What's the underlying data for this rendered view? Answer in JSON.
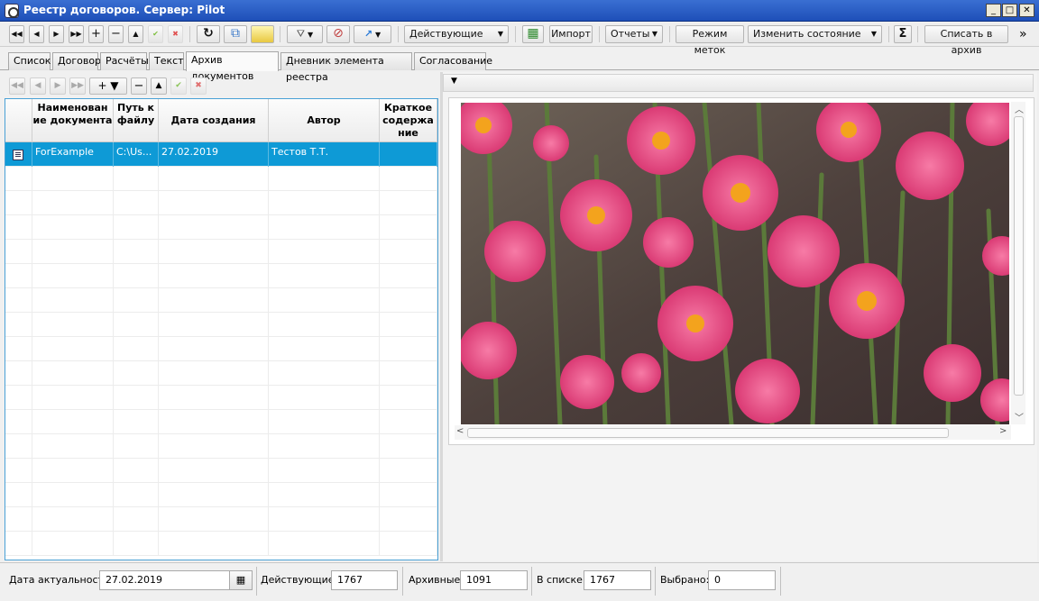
{
  "window": {
    "title": "Реестр договоров. Сервер: Pilot",
    "minimize": "_",
    "maximize": "□",
    "close": "✕"
  },
  "toolbar": {
    "nav_first": "◀◀",
    "nav_prev": "◀",
    "nav_next": "▶",
    "nav_last": "▶▶",
    "add": "+",
    "remove": "−",
    "up": "▲",
    "apply": "✔",
    "cancel": "✖",
    "refresh": "↻",
    "copy": "⧉",
    "status_combo": "Действующие",
    "import_label": "Импорт",
    "reports_label": "Отчеты",
    "marks_mode_label": "Режим меток",
    "change_state_label": "Изменить состояние",
    "sum": "Σ",
    "archive_label": "Списать в архив",
    "more": "»",
    "dropdown": "▼"
  },
  "tabs": [
    {
      "label": "Список"
    },
    {
      "label": "Договор"
    },
    {
      "label": "Расчёты"
    },
    {
      "label": "Текст"
    },
    {
      "label": "Архив документов"
    },
    {
      "label": "Дневник элемента реестра"
    },
    {
      "label": "Согласование"
    }
  ],
  "left_toolbar": {
    "first": "◀◀",
    "prev": "◀",
    "next": "▶",
    "last": "▶▶",
    "add": "+ ▼",
    "remove": "−",
    "up": "▲",
    "apply": "✔",
    "cancel": "✖"
  },
  "grid": {
    "columns": [
      {
        "label": "Наименован ие документа"
      },
      {
        "label": "Путь к файлу"
      },
      {
        "label": "Дата создания"
      },
      {
        "label": "Автор"
      },
      {
        "label": "Краткое содержа ние"
      }
    ],
    "rows": [
      {
        "name": "ForExample",
        "path": "C:\\Us...",
        "date": "27.02.2019",
        "author": "Тестов Т.Т.",
        "summary": ""
      }
    ]
  },
  "right_panel": {
    "caret": "▼",
    "scroll_up": "︿",
    "scroll_down": "﹀",
    "scroll_left": "<",
    "scroll_right": ">"
  },
  "status": {
    "date_label": "Дата актуальности",
    "date_value": "27.02.2019",
    "calendar": "▦",
    "active_label": "Действующие:",
    "active_value": "1767",
    "archive_label": "Архивные:",
    "archive_value": "1091",
    "list_label": "В списке:",
    "list_value": "1767",
    "selected_label": "Выбрано:",
    "selected_value": "0"
  },
  "colors": {
    "selection": "#0e9ad6",
    "title_bar": "#1e4fb8",
    "flower_pink": "#e63f7d",
    "background_dark": "#4a3b38"
  }
}
